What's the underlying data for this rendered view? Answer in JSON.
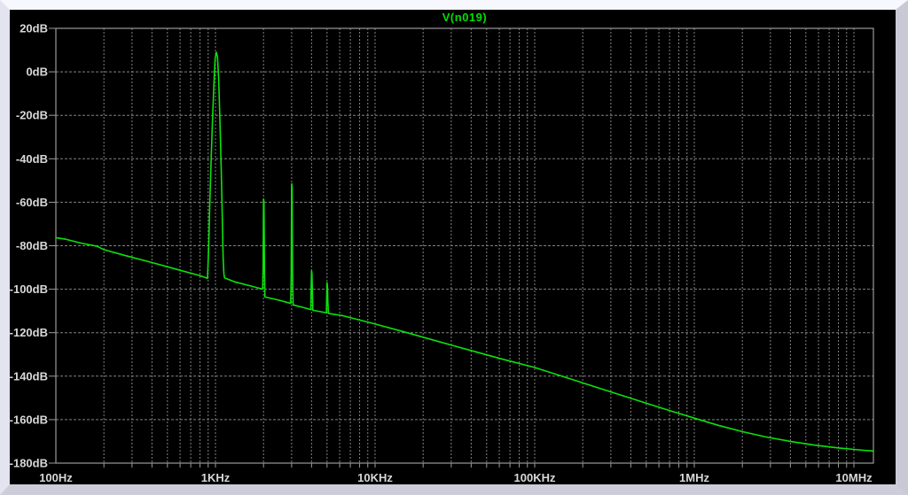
{
  "window": {
    "pane_background": "#000000",
    "bevel_top": "#f7f7ff",
    "bevel_left": "#e4e4f0",
    "bevel_right": "#c9c9d6",
    "bevel_bottom": "#cdcdda"
  },
  "chart_data": {
    "type": "line",
    "title": "V(n019)",
    "title_color": "#00e000",
    "trace_color": "#0ce20c",
    "grid_color": "#828282",
    "axis_color": "#9a9a9a",
    "label_color": "#d8d8d8",
    "x_scale": "log",
    "x_unit": "Hz",
    "y_unit": "dB",
    "xlim_log10": [
      2.0,
      7.122
    ],
    "ylim": [
      -180,
      20
    ],
    "grid": true,
    "legend_position": "top-center",
    "y_ticks": [
      {
        "value": 20,
        "label": "20dB"
      },
      {
        "value": 0,
        "label": "0dB"
      },
      {
        "value": -20,
        "label": "-20dB"
      },
      {
        "value": -40,
        "label": "-40dB"
      },
      {
        "value": -60,
        "label": "-60dB"
      },
      {
        "value": -80,
        "label": "-80dB"
      },
      {
        "value": -100,
        "label": "-100dB"
      },
      {
        "value": -120,
        "label": "-120dB"
      },
      {
        "value": -140,
        "label": "-140dB"
      },
      {
        "value": -160,
        "label": "-160dB"
      },
      {
        "value": -180,
        "label": "-180dB"
      }
    ],
    "x_ticks": [
      {
        "log10": 2,
        "label": "100Hz"
      },
      {
        "log10": 3,
        "label": "1KHz"
      },
      {
        "log10": 4,
        "label": "10KHz"
      },
      {
        "log10": 5,
        "label": "100KHz"
      },
      {
        "log10": 6,
        "label": "1MHz"
      },
      {
        "log10": 7,
        "label": "10MHz"
      }
    ],
    "peaks": [
      {
        "freq": "1KHz",
        "level_db": 9
      },
      {
        "freq": "2KHz",
        "level_db": -58.5
      },
      {
        "freq": "3KHz",
        "level_db": -51.5
      },
      {
        "freq": "4KHz",
        "level_db": -91.5
      },
      {
        "freq": "5KHz",
        "level_db": -97
      }
    ],
    "noise_floor": {
      "at_100Hz_db": -76.3,
      "at_10MHz_db": -174
    },
    "trace_points_log10f_db": [
      [
        2.0,
        -76.3
      ],
      [
        2.06,
        -77.0
      ],
      [
        2.16,
        -78.8
      ],
      [
        2.26,
        -80.3
      ],
      [
        2.3,
        -81.8
      ],
      [
        2.45,
        -84.8
      ],
      [
        2.6,
        -87.7
      ],
      [
        2.75,
        -90.7
      ],
      [
        2.9,
        -93.7
      ],
      [
        2.95,
        -95.0
      ],
      [
        2.958,
        -80
      ],
      [
        2.964,
        -62
      ],
      [
        2.972,
        -42
      ],
      [
        2.98,
        -25
      ],
      [
        2.99,
        -6
      ],
      [
        2.998,
        6
      ],
      [
        3.005,
        9
      ],
      [
        3.012,
        7
      ],
      [
        3.02,
        -3
      ],
      [
        3.028,
        -22
      ],
      [
        3.036,
        -45
      ],
      [
        3.042,
        -65
      ],
      [
        3.048,
        -85
      ],
      [
        3.053,
        -93
      ],
      [
        3.057,
        -94.8
      ],
      [
        3.12,
        -96.6
      ],
      [
        3.22,
        -98.5
      ],
      [
        3.287,
        -99.8
      ],
      [
        3.2955,
        -99.9
      ],
      [
        3.2985,
        -90
      ],
      [
        3.301,
        -58.5
      ],
      [
        3.304,
        -60
      ],
      [
        3.307,
        -92
      ],
      [
        3.31,
        -103.6
      ],
      [
        3.39,
        -104.9
      ],
      [
        3.466,
        -106.4
      ],
      [
        3.4715,
        -106.5
      ],
      [
        3.4745,
        -93
      ],
      [
        3.477,
        -51.5
      ],
      [
        3.48,
        -53
      ],
      [
        3.483,
        -93
      ],
      [
        3.4865,
        -107.2
      ],
      [
        3.545,
        -108.3
      ],
      [
        3.5935,
        -109.3
      ],
      [
        3.597,
        -109.4
      ],
      [
        3.5995,
        -99
      ],
      [
        3.602,
        -91.5
      ],
      [
        3.6045,
        -93
      ],
      [
        3.607,
        -101
      ],
      [
        3.61,
        -109.7
      ],
      [
        3.655,
        -110.3
      ],
      [
        3.6915,
        -110.8
      ],
      [
        3.695,
        -110.9
      ],
      [
        3.697,
        -102
      ],
      [
        3.699,
        -97
      ],
      [
        3.7015,
        -99
      ],
      [
        3.704,
        -105
      ],
      [
        3.7075,
        -111.1
      ],
      [
        3.8,
        -112.2
      ],
      [
        4.0,
        -116.0
      ],
      [
        4.2,
        -120.0
      ],
      [
        4.4,
        -124.1
      ],
      [
        4.6,
        -128.2
      ],
      [
        4.8,
        -132.2
      ],
      [
        5.0,
        -136.0
      ],
      [
        5.2,
        -140.7
      ],
      [
        5.4,
        -145.4
      ],
      [
        5.6,
        -150.1
      ],
      [
        5.8,
        -154.8
      ],
      [
        6.0,
        -159.3
      ],
      [
        6.15,
        -162.6
      ],
      [
        6.3,
        -165.5
      ],
      [
        6.45,
        -168.0
      ],
      [
        6.6,
        -170.0
      ],
      [
        6.75,
        -171.7
      ],
      [
        6.9,
        -173.0
      ],
      [
        7.0,
        -173.7
      ],
      [
        7.06,
        -174.1
      ],
      [
        7.122,
        -174.4
      ]
    ]
  }
}
